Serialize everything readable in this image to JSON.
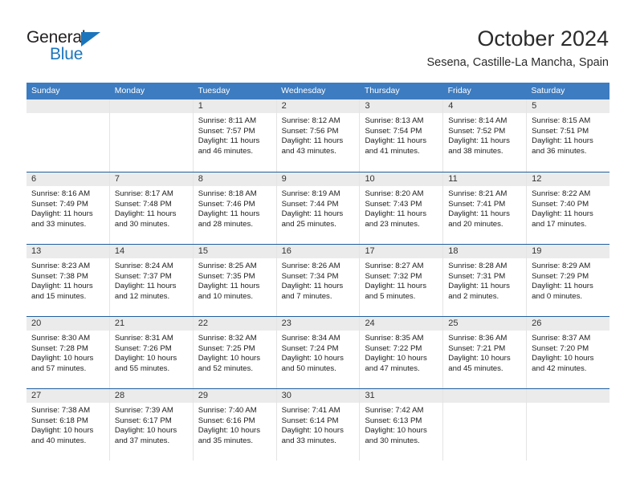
{
  "brand": {
    "name_part1": "General",
    "name_part2": "Blue",
    "triangle_icon": "triangle-icon",
    "accent_color": "#1b75bc"
  },
  "header": {
    "month_title": "October 2024",
    "location": "Sesena, Castille-La Mancha, Spain"
  },
  "theme": {
    "header_row_bg": "#3d7cc0",
    "week_separator": "#1f5fa0",
    "daynum_bg": "#ebebeb",
    "text_color": "#1c1c1c"
  },
  "calendar": {
    "day_names": [
      "Sunday",
      "Monday",
      "Tuesday",
      "Wednesday",
      "Thursday",
      "Friday",
      "Saturday"
    ],
    "weeks": [
      [
        {
          "day": "",
          "empty": true
        },
        {
          "day": "",
          "empty": true
        },
        {
          "day": "1",
          "sunrise": "Sunrise: 8:11 AM",
          "sunset": "Sunset: 7:57 PM",
          "daylight_line1": "Daylight: 11 hours",
          "daylight_line2": "and 46 minutes."
        },
        {
          "day": "2",
          "sunrise": "Sunrise: 8:12 AM",
          "sunset": "Sunset: 7:56 PM",
          "daylight_line1": "Daylight: 11 hours",
          "daylight_line2": "and 43 minutes."
        },
        {
          "day": "3",
          "sunrise": "Sunrise: 8:13 AM",
          "sunset": "Sunset: 7:54 PM",
          "daylight_line1": "Daylight: 11 hours",
          "daylight_line2": "and 41 minutes."
        },
        {
          "day": "4",
          "sunrise": "Sunrise: 8:14 AM",
          "sunset": "Sunset: 7:52 PM",
          "daylight_line1": "Daylight: 11 hours",
          "daylight_line2": "and 38 minutes."
        },
        {
          "day": "5",
          "sunrise": "Sunrise: 8:15 AM",
          "sunset": "Sunset: 7:51 PM",
          "daylight_line1": "Daylight: 11 hours",
          "daylight_line2": "and 36 minutes."
        }
      ],
      [
        {
          "day": "6",
          "sunrise": "Sunrise: 8:16 AM",
          "sunset": "Sunset: 7:49 PM",
          "daylight_line1": "Daylight: 11 hours",
          "daylight_line2": "and 33 minutes."
        },
        {
          "day": "7",
          "sunrise": "Sunrise: 8:17 AM",
          "sunset": "Sunset: 7:48 PM",
          "daylight_line1": "Daylight: 11 hours",
          "daylight_line2": "and 30 minutes."
        },
        {
          "day": "8",
          "sunrise": "Sunrise: 8:18 AM",
          "sunset": "Sunset: 7:46 PM",
          "daylight_line1": "Daylight: 11 hours",
          "daylight_line2": "and 28 minutes."
        },
        {
          "day": "9",
          "sunrise": "Sunrise: 8:19 AM",
          "sunset": "Sunset: 7:44 PM",
          "daylight_line1": "Daylight: 11 hours",
          "daylight_line2": "and 25 minutes."
        },
        {
          "day": "10",
          "sunrise": "Sunrise: 8:20 AM",
          "sunset": "Sunset: 7:43 PM",
          "daylight_line1": "Daylight: 11 hours",
          "daylight_line2": "and 23 minutes."
        },
        {
          "day": "11",
          "sunrise": "Sunrise: 8:21 AM",
          "sunset": "Sunset: 7:41 PM",
          "daylight_line1": "Daylight: 11 hours",
          "daylight_line2": "and 20 minutes."
        },
        {
          "day": "12",
          "sunrise": "Sunrise: 8:22 AM",
          "sunset": "Sunset: 7:40 PM",
          "daylight_line1": "Daylight: 11 hours",
          "daylight_line2": "and 17 minutes."
        }
      ],
      [
        {
          "day": "13",
          "sunrise": "Sunrise: 8:23 AM",
          "sunset": "Sunset: 7:38 PM",
          "daylight_line1": "Daylight: 11 hours",
          "daylight_line2": "and 15 minutes."
        },
        {
          "day": "14",
          "sunrise": "Sunrise: 8:24 AM",
          "sunset": "Sunset: 7:37 PM",
          "daylight_line1": "Daylight: 11 hours",
          "daylight_line2": "and 12 minutes."
        },
        {
          "day": "15",
          "sunrise": "Sunrise: 8:25 AM",
          "sunset": "Sunset: 7:35 PM",
          "daylight_line1": "Daylight: 11 hours",
          "daylight_line2": "and 10 minutes."
        },
        {
          "day": "16",
          "sunrise": "Sunrise: 8:26 AM",
          "sunset": "Sunset: 7:34 PM",
          "daylight_line1": "Daylight: 11 hours",
          "daylight_line2": "and 7 minutes."
        },
        {
          "day": "17",
          "sunrise": "Sunrise: 8:27 AM",
          "sunset": "Sunset: 7:32 PM",
          "daylight_line1": "Daylight: 11 hours",
          "daylight_line2": "and 5 minutes."
        },
        {
          "day": "18",
          "sunrise": "Sunrise: 8:28 AM",
          "sunset": "Sunset: 7:31 PM",
          "daylight_line1": "Daylight: 11 hours",
          "daylight_line2": "and 2 minutes."
        },
        {
          "day": "19",
          "sunrise": "Sunrise: 8:29 AM",
          "sunset": "Sunset: 7:29 PM",
          "daylight_line1": "Daylight: 11 hours",
          "daylight_line2": "and 0 minutes."
        }
      ],
      [
        {
          "day": "20",
          "sunrise": "Sunrise: 8:30 AM",
          "sunset": "Sunset: 7:28 PM",
          "daylight_line1": "Daylight: 10 hours",
          "daylight_line2": "and 57 minutes."
        },
        {
          "day": "21",
          "sunrise": "Sunrise: 8:31 AM",
          "sunset": "Sunset: 7:26 PM",
          "daylight_line1": "Daylight: 10 hours",
          "daylight_line2": "and 55 minutes."
        },
        {
          "day": "22",
          "sunrise": "Sunrise: 8:32 AM",
          "sunset": "Sunset: 7:25 PM",
          "daylight_line1": "Daylight: 10 hours",
          "daylight_line2": "and 52 minutes."
        },
        {
          "day": "23",
          "sunrise": "Sunrise: 8:34 AM",
          "sunset": "Sunset: 7:24 PM",
          "daylight_line1": "Daylight: 10 hours",
          "daylight_line2": "and 50 minutes."
        },
        {
          "day": "24",
          "sunrise": "Sunrise: 8:35 AM",
          "sunset": "Sunset: 7:22 PM",
          "daylight_line1": "Daylight: 10 hours",
          "daylight_line2": "and 47 minutes."
        },
        {
          "day": "25",
          "sunrise": "Sunrise: 8:36 AM",
          "sunset": "Sunset: 7:21 PM",
          "daylight_line1": "Daylight: 10 hours",
          "daylight_line2": "and 45 minutes."
        },
        {
          "day": "26",
          "sunrise": "Sunrise: 8:37 AM",
          "sunset": "Sunset: 7:20 PM",
          "daylight_line1": "Daylight: 10 hours",
          "daylight_line2": "and 42 minutes."
        }
      ],
      [
        {
          "day": "27",
          "sunrise": "Sunrise: 7:38 AM",
          "sunset": "Sunset: 6:18 PM",
          "daylight_line1": "Daylight: 10 hours",
          "daylight_line2": "and 40 minutes."
        },
        {
          "day": "28",
          "sunrise": "Sunrise: 7:39 AM",
          "sunset": "Sunset: 6:17 PM",
          "daylight_line1": "Daylight: 10 hours",
          "daylight_line2": "and 37 minutes."
        },
        {
          "day": "29",
          "sunrise": "Sunrise: 7:40 AM",
          "sunset": "Sunset: 6:16 PM",
          "daylight_line1": "Daylight: 10 hours",
          "daylight_line2": "and 35 minutes."
        },
        {
          "day": "30",
          "sunrise": "Sunrise: 7:41 AM",
          "sunset": "Sunset: 6:14 PM",
          "daylight_line1": "Daylight: 10 hours",
          "daylight_line2": "and 33 minutes."
        },
        {
          "day": "31",
          "sunrise": "Sunrise: 7:42 AM",
          "sunset": "Sunset: 6:13 PM",
          "daylight_line1": "Daylight: 10 hours",
          "daylight_line2": "and 30 minutes."
        },
        {
          "day": "",
          "empty": true
        },
        {
          "day": "",
          "empty": true
        }
      ]
    ]
  }
}
